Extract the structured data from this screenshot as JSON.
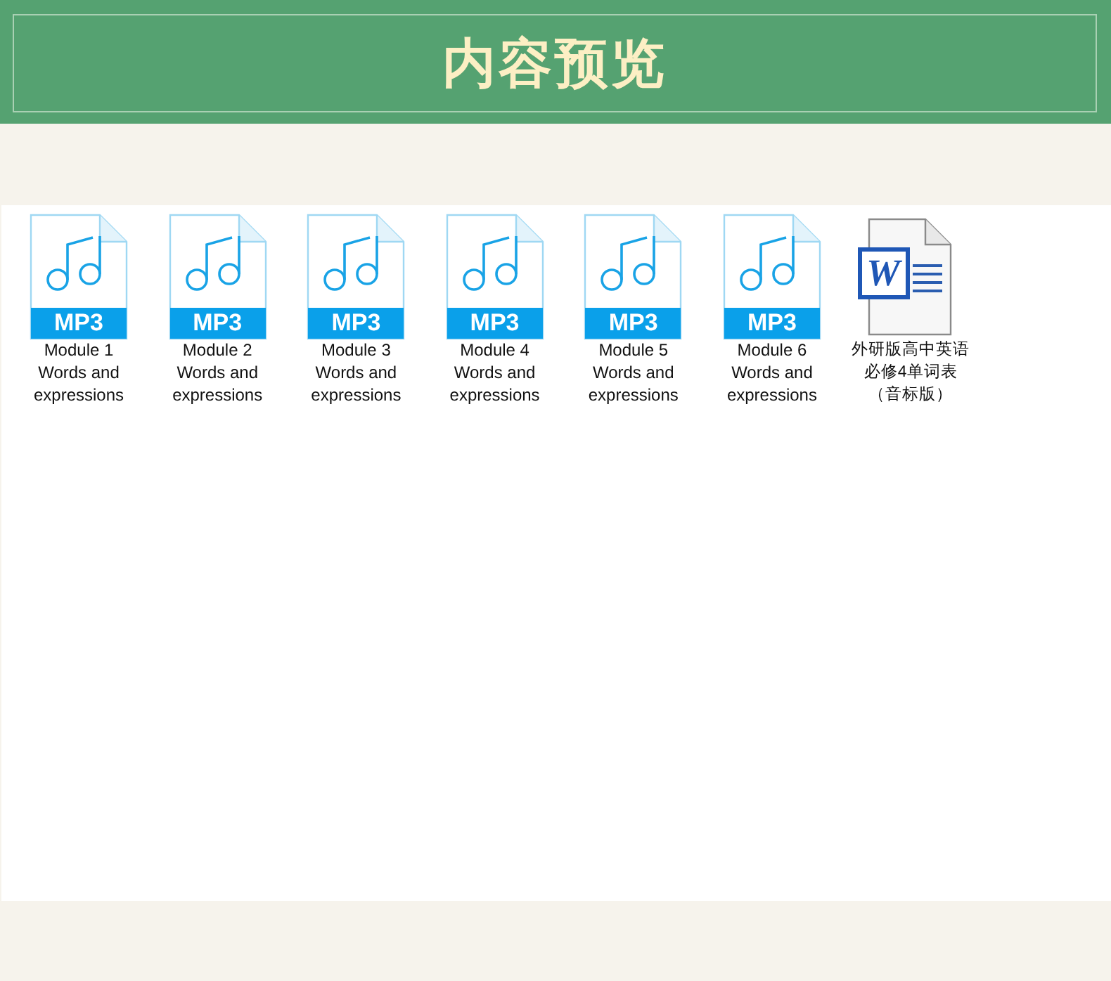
{
  "header": {
    "title": "内容预览"
  },
  "files": [
    {
      "kind": "mp3",
      "badge": "MP3",
      "name": "Module 1 Words and expressions"
    },
    {
      "kind": "mp3",
      "badge": "MP3",
      "name": "Module 2 Words and expressions"
    },
    {
      "kind": "mp3",
      "badge": "MP3",
      "name": "Module 3 Words and expressions"
    },
    {
      "kind": "mp3",
      "badge": "MP3",
      "name": "Module 4 Words and expressions"
    },
    {
      "kind": "mp3",
      "badge": "MP3",
      "name": "Module 5 Words and expressions"
    },
    {
      "kind": "mp3",
      "badge": "MP3",
      "name": "Module 6 Words and expressions"
    },
    {
      "kind": "word",
      "badge": "W",
      "name": "外研版高中英语必修4单词表（音标版）"
    }
  ]
}
